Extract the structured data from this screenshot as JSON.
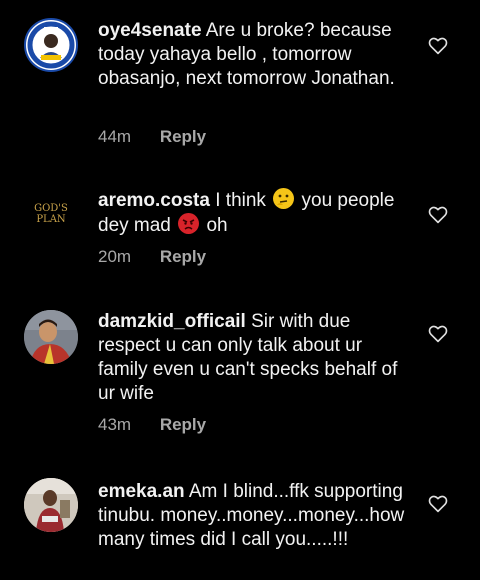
{
  "comments": [
    {
      "username": "oye4senate",
      "text": "Are u broke? because today yahaya bello , tomorrow obasanjo, next tomorrow Jonathan.",
      "time": "44m",
      "reply": "Reply",
      "avatar_icon": "campaign-logo-avatar",
      "avatar_text": "OYE FOR SENATE"
    },
    {
      "username": "aremo.costa",
      "text_parts": [
        "I think",
        "you people dey mad",
        "oh"
      ],
      "emojis": [
        "thinking-face-emoji",
        "angry-face-emoji"
      ],
      "time": "20m",
      "reply": "Reply",
      "avatar_icon": "gods-plan-text-avatar",
      "avatar_text": "GOD'S PLAN"
    },
    {
      "username": "damzkid_officail",
      "text": "Sir with due respect u can only talk about ur family even u can't specks behalf of ur wife",
      "time": "43m",
      "reply": "Reply",
      "avatar_icon": "user-photo-avatar"
    },
    {
      "username": "emeka.an",
      "text": "Am I blind...ffk supporting tinubu. money..money...money...how many times did I call you.....!!!",
      "time": "",
      "reply": "",
      "avatar_icon": "user-photo-avatar"
    }
  ],
  "colors": {
    "background": "#000000",
    "text": "#f2f2f2",
    "meta": "#a8a8a8"
  },
  "icons": {
    "like": "heart-outline-icon"
  }
}
